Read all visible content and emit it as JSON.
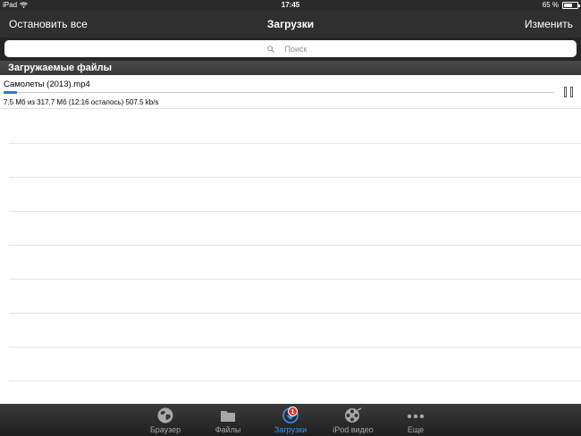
{
  "status_bar": {
    "device": "iPad",
    "time": "17:45",
    "battery": "65 %",
    "battery_level": 0.65
  },
  "nav": {
    "left_button": "Остановить все",
    "title": "Загрузки",
    "right_button": "Изменить"
  },
  "search": {
    "placeholder": "Поиск"
  },
  "section": {
    "title": "Загружаемые файлы"
  },
  "downloads": [
    {
      "name": "Самолеты (2013).mp4",
      "stats": "7.5 Мб из 317.7 Мб (12:16 осталось) 507.5 kb/s",
      "progress": 0.024
    }
  ],
  "tabs": [
    {
      "label": "Браузер",
      "icon": "globe-icon",
      "active": false
    },
    {
      "label": "Файлы",
      "icon": "folder-icon",
      "active": false
    },
    {
      "label": "Загрузки",
      "icon": "download-icon",
      "active": true,
      "badge": "1"
    },
    {
      "label": "iPod видео",
      "icon": "film-reel-icon",
      "active": false
    },
    {
      "label": "Еще",
      "icon": "more-dots-icon",
      "active": false
    }
  ],
  "colors": {
    "accent": "#3d93f0",
    "badge": "#e2312b",
    "bar": "#2f2f2f"
  }
}
